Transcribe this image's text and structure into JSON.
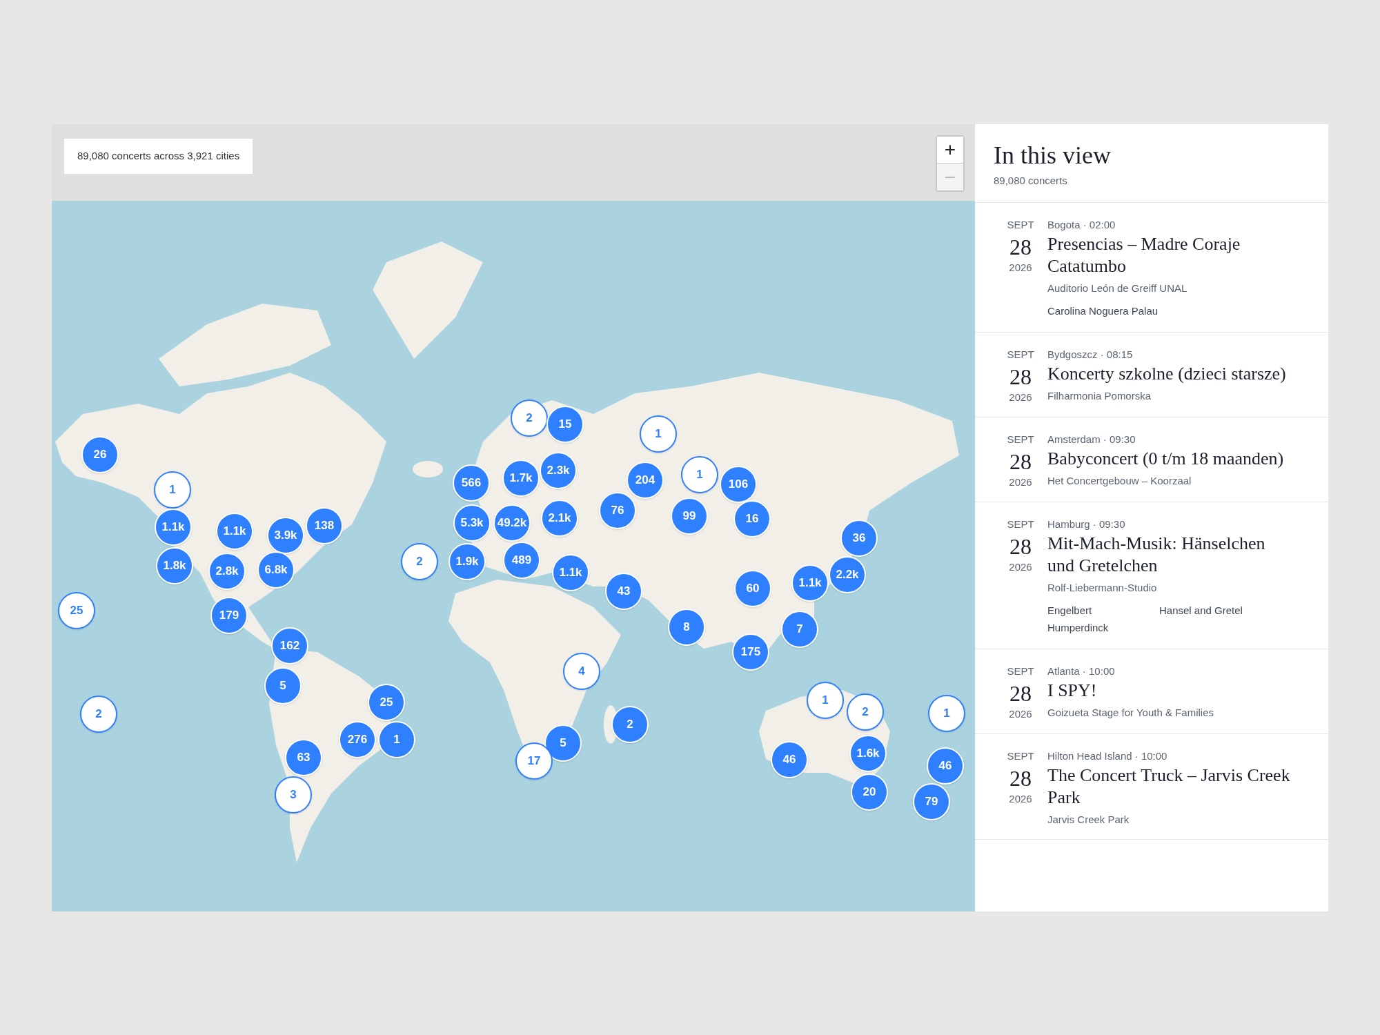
{
  "map": {
    "summary": "89,080 concerts across 3,921 cities",
    "zoom_controls": [
      {
        "label": "+",
        "disabled": false
      },
      {
        "label": "−",
        "disabled": true
      }
    ],
    "markers": [
      {
        "count": "26",
        "kind": "filled"
      },
      {
        "count": "1",
        "kind": "outline"
      },
      {
        "count": "25",
        "kind": "outline"
      },
      {
        "count": "2",
        "kind": "outline"
      },
      {
        "count": "1.1k",
        "kind": "filled"
      },
      {
        "count": "1.8k",
        "kind": "filled"
      },
      {
        "count": "1.1k",
        "kind": "filled"
      },
      {
        "count": "2.8k",
        "kind": "filled"
      },
      {
        "count": "3.9k",
        "kind": "filled"
      },
      {
        "count": "6.8k",
        "kind": "filled"
      },
      {
        "count": "138",
        "kind": "filled"
      },
      {
        "count": "179",
        "kind": "filled"
      },
      {
        "count": "162",
        "kind": "filled"
      },
      {
        "count": "5",
        "kind": "filled"
      },
      {
        "count": "25",
        "kind": "filled"
      },
      {
        "count": "276",
        "kind": "filled"
      },
      {
        "count": "1",
        "kind": "filled"
      },
      {
        "count": "63",
        "kind": "filled"
      },
      {
        "count": "3",
        "kind": "outline"
      },
      {
        "count": "2",
        "kind": "outline"
      },
      {
        "count": "2",
        "kind": "outline"
      },
      {
        "count": "15",
        "kind": "filled"
      },
      {
        "count": "1",
        "kind": "outline"
      },
      {
        "count": "566",
        "kind": "filled"
      },
      {
        "count": "1.7k",
        "kind": "filled"
      },
      {
        "count": "2.3k",
        "kind": "filled"
      },
      {
        "count": "5.3k",
        "kind": "filled"
      },
      {
        "count": "49.2k",
        "kind": "filled"
      },
      {
        "count": "2.1k",
        "kind": "filled"
      },
      {
        "count": "1.9k",
        "kind": "filled"
      },
      {
        "count": "489",
        "kind": "filled"
      },
      {
        "count": "1.1k",
        "kind": "filled"
      },
      {
        "count": "204",
        "kind": "filled"
      },
      {
        "count": "76",
        "kind": "filled"
      },
      {
        "count": "1",
        "kind": "outline"
      },
      {
        "count": "106",
        "kind": "filled"
      },
      {
        "count": "99",
        "kind": "filled"
      },
      {
        "count": "16",
        "kind": "filled"
      },
      {
        "count": "43",
        "kind": "filled"
      },
      {
        "count": "60",
        "kind": "filled"
      },
      {
        "count": "36",
        "kind": "filled"
      },
      {
        "count": "2.2k",
        "kind": "filled"
      },
      {
        "count": "1.1k",
        "kind": "filled"
      },
      {
        "count": "8",
        "kind": "filled"
      },
      {
        "count": "7",
        "kind": "filled"
      },
      {
        "count": "175",
        "kind": "filled"
      },
      {
        "count": "4",
        "kind": "outline"
      },
      {
        "count": "2",
        "kind": "filled"
      },
      {
        "count": "5",
        "kind": "filled"
      },
      {
        "count": "17",
        "kind": "outline"
      },
      {
        "count": "1",
        "kind": "outline"
      },
      {
        "count": "2",
        "kind": "outline"
      },
      {
        "count": "1",
        "kind": "outline"
      },
      {
        "count": "46",
        "kind": "filled"
      },
      {
        "count": "1.6k",
        "kind": "filled"
      },
      {
        "count": "20",
        "kind": "filled"
      },
      {
        "count": "46",
        "kind": "filled"
      },
      {
        "count": "79",
        "kind": "filled"
      }
    ]
  },
  "sidebar": {
    "title": "In this view",
    "subtitle": "89,080 concerts",
    "events": [
      {
        "month": "SEPT",
        "day": "28",
        "year": "2026",
        "place_time": "Bogota · 02:00",
        "title": "Presencias – Madre Coraje Catatumbo",
        "venue": "Auditorio León de Greiff UNAL",
        "performers": [
          "Carolina Noguera Palau"
        ]
      },
      {
        "month": "SEPT",
        "day": "28",
        "year": "2026",
        "place_time": "Bydgoszcz · 08:15",
        "title": "Koncerty szkolne (dzieci starsze)",
        "venue": "Filharmonia Pomorska"
      },
      {
        "month": "SEPT",
        "day": "28",
        "year": "2026",
        "place_time": "Amsterdam · 09:30",
        "title": "Babyconcert (0 t/m 18 maanden)",
        "venue": "Het Concertgebouw – Koorzaal"
      },
      {
        "month": "SEPT",
        "day": "28",
        "year": "2026",
        "place_time": "Hamburg · 09:30",
        "title": "Mit-Mach-Musik: Hänselchen und Gretelchen",
        "venue": "Rolf-Liebermann-Studio",
        "performers": [
          "Engelbert Humperdinck",
          "Hansel and Gretel"
        ]
      },
      {
        "month": "SEPT",
        "day": "28",
        "year": "2026",
        "place_time": "Atlanta · 10:00",
        "title": "I SPY!",
        "venue": "Goizueta Stage for Youth & Families"
      },
      {
        "month": "SEPT",
        "day": "28",
        "year": "2026",
        "place_time": "Hilton Head Island · 10:00",
        "title": "The Concert Truck – Jarvis Creek Park",
        "venue": "Jarvis Creek Park"
      }
    ]
  }
}
